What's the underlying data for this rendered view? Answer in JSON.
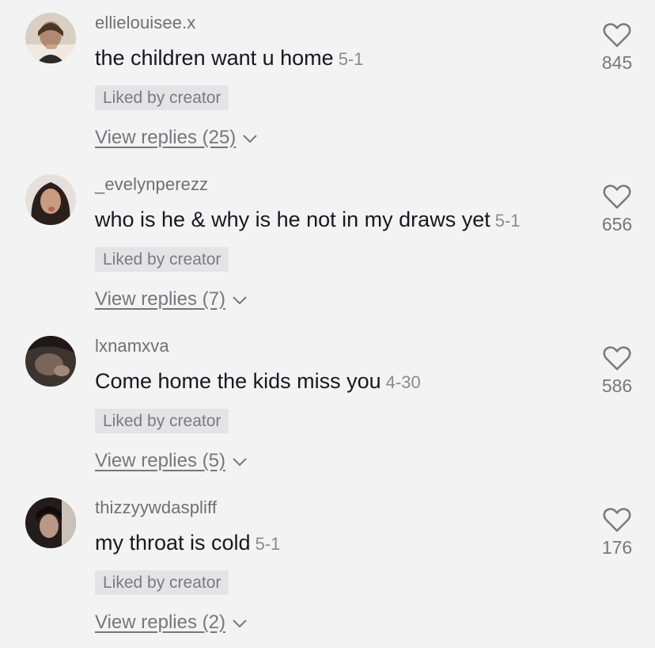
{
  "badge_label": "Liked by creator",
  "comments": [
    {
      "username": "ellielouisee.x",
      "text": "the children want u home",
      "date": "5-1",
      "replies_label": "View replies (25)",
      "likes": "845",
      "avatar_color": "#8a7a6c"
    },
    {
      "username": "_evelynperezz",
      "text": "who is he & why is he not in my draws yet",
      "date": "5-1",
      "replies_label": "View replies (7)",
      "likes": "656",
      "avatar_color": "#6b4a3c"
    },
    {
      "username": "lxnamxva",
      "text": "Come home the kids miss you",
      "date": "4-30",
      "replies_label": "View replies (5)",
      "likes": "586",
      "avatar_color": "#5a4a42"
    },
    {
      "username": "thizzyywdaspliff",
      "text": "my throat is cold",
      "date": "5-1",
      "replies_label": "View replies (2)",
      "likes": "176",
      "avatar_color": "#3a2e2a"
    }
  ]
}
